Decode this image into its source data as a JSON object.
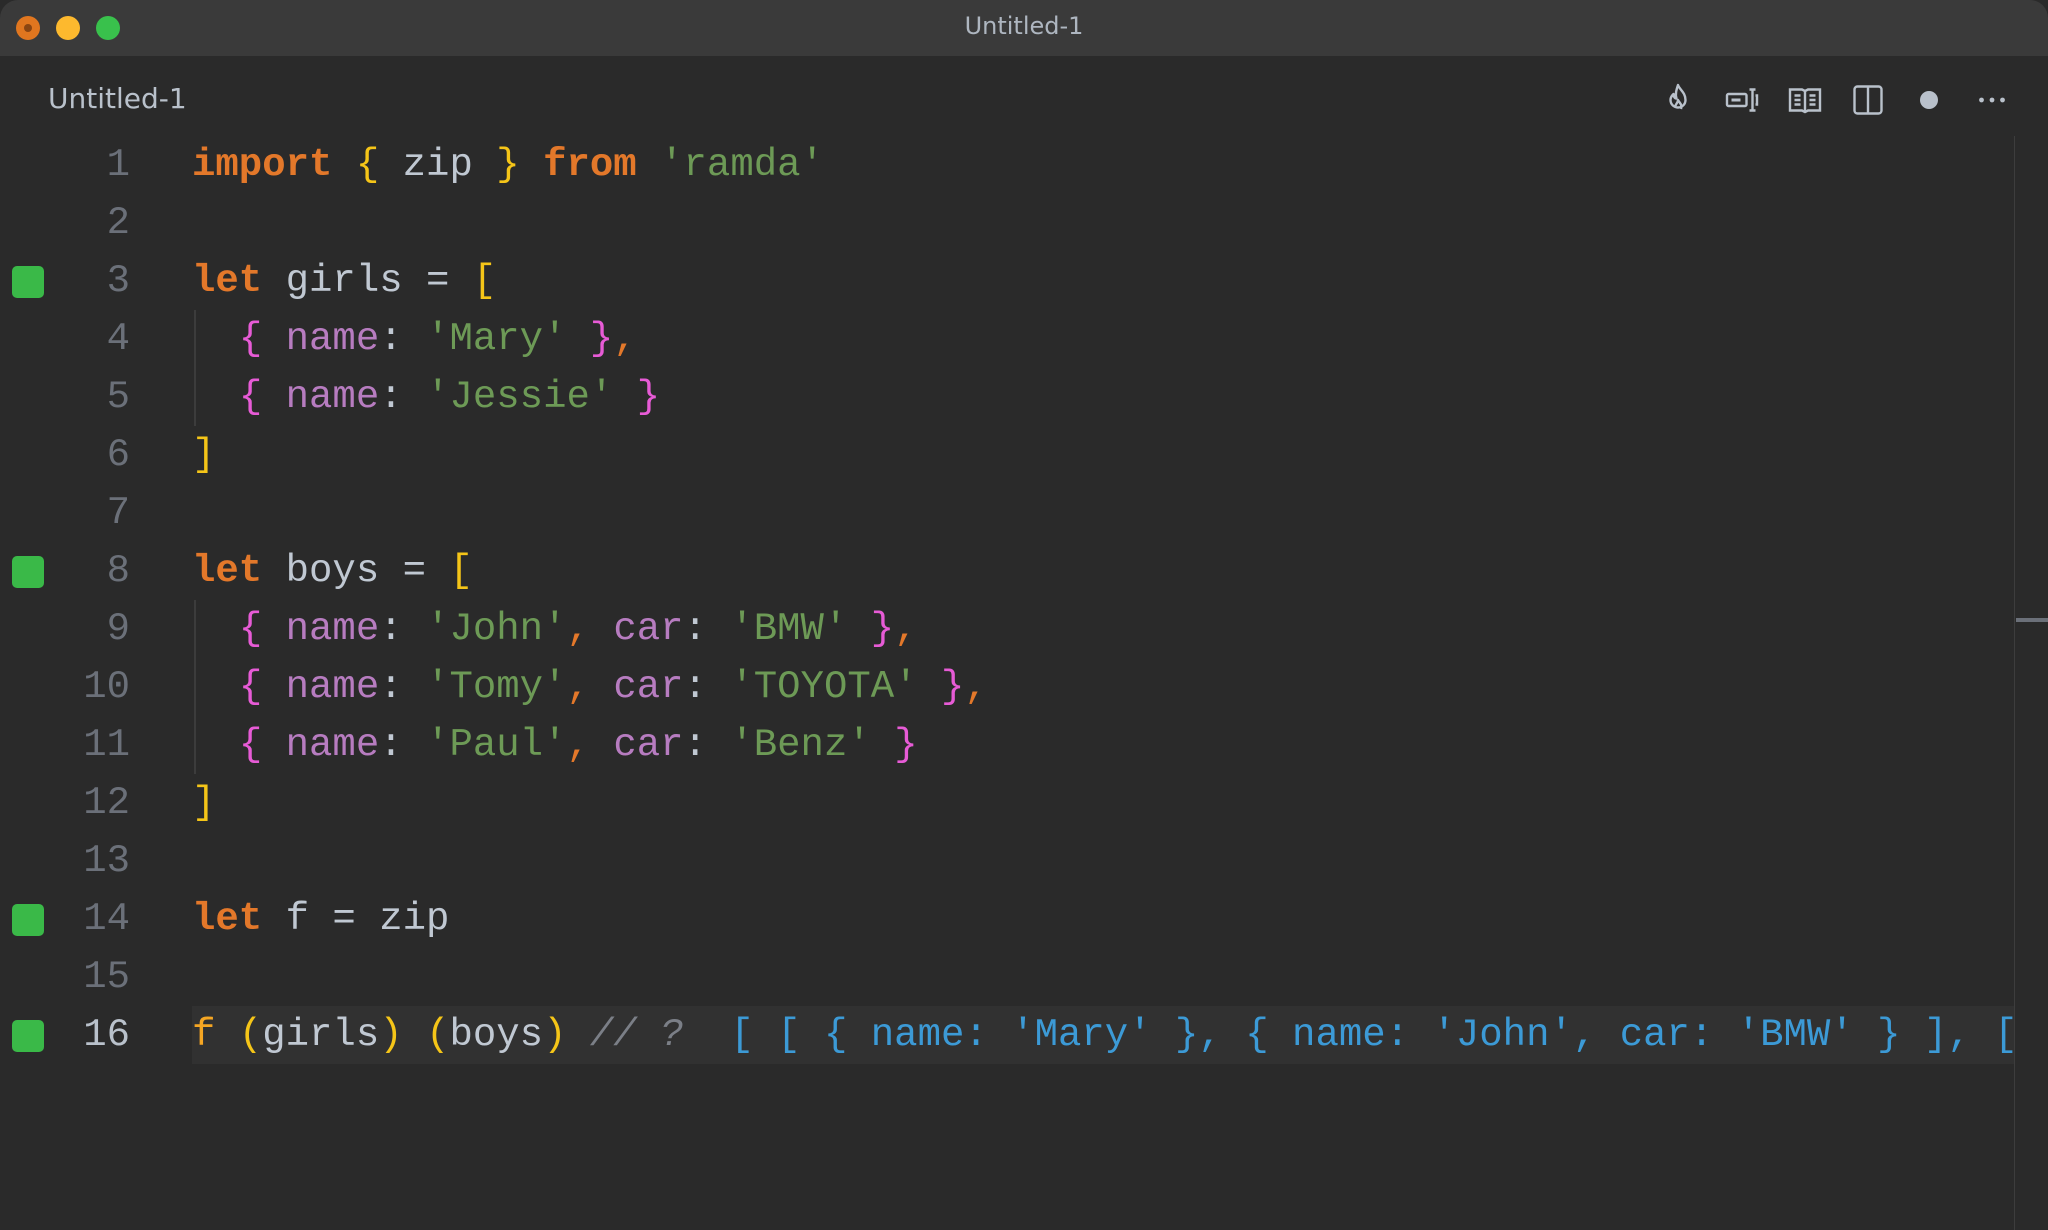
{
  "window": {
    "title": "Untitled-1",
    "traffic_lights": [
      "close",
      "minimize",
      "maximize"
    ]
  },
  "tab": {
    "label": "Untitled-1"
  },
  "toolbar": {
    "icons": [
      "flame-icon",
      "text-cursor-box-icon",
      "open-book-icon",
      "split-editor-icon",
      "unsaved-dot-icon",
      "more-icon"
    ]
  },
  "colors": {
    "keyword": "#e3782a",
    "bracket": "#f5c518",
    "brace": "#e75bd6",
    "property": "#b77cc0",
    "string": "#6d9a56",
    "result": "#3c9ad6",
    "marker": "#3ab948"
  },
  "lines": [
    {
      "n": "1",
      "marker": false,
      "tokens": [
        [
          "k",
          "import"
        ],
        [
          "id",
          " "
        ],
        [
          "br",
          "{"
        ],
        [
          "id",
          " zip "
        ],
        [
          "br",
          "}"
        ],
        [
          "id",
          " "
        ],
        [
          "k",
          "from"
        ],
        [
          "id",
          " "
        ],
        [
          "str",
          "'ramda'"
        ]
      ]
    },
    {
      "n": "2",
      "marker": false,
      "tokens": []
    },
    {
      "n": "3",
      "marker": true,
      "tokens": [
        [
          "k",
          "let"
        ],
        [
          "id",
          " girls = "
        ],
        [
          "br",
          "["
        ]
      ]
    },
    {
      "n": "4",
      "marker": false,
      "tokens": [
        [
          "id",
          "  "
        ],
        [
          "cb",
          "{"
        ],
        [
          "id",
          " "
        ],
        [
          "prop",
          "name"
        ],
        [
          "pun",
          ": "
        ],
        [
          "str",
          "'Mary'"
        ],
        [
          "id",
          " "
        ],
        [
          "cb",
          "}"
        ],
        [
          "comma",
          ","
        ]
      ]
    },
    {
      "n": "5",
      "marker": false,
      "tokens": [
        [
          "id",
          "  "
        ],
        [
          "cb",
          "{"
        ],
        [
          "id",
          " "
        ],
        [
          "prop",
          "name"
        ],
        [
          "pun",
          ": "
        ],
        [
          "str",
          "'Jessie'"
        ],
        [
          "id",
          " "
        ],
        [
          "cb",
          "}"
        ]
      ]
    },
    {
      "n": "6",
      "marker": false,
      "tokens": [
        [
          "br",
          "]"
        ]
      ]
    },
    {
      "n": "7",
      "marker": false,
      "tokens": []
    },
    {
      "n": "8",
      "marker": true,
      "tokens": [
        [
          "k",
          "let"
        ],
        [
          "id",
          " boys = "
        ],
        [
          "br",
          "["
        ]
      ]
    },
    {
      "n": "9",
      "marker": false,
      "tokens": [
        [
          "id",
          "  "
        ],
        [
          "cb",
          "{"
        ],
        [
          "id",
          " "
        ],
        [
          "prop",
          "name"
        ],
        [
          "pun",
          ": "
        ],
        [
          "str",
          "'John'"
        ],
        [
          "comma",
          ","
        ],
        [
          "id",
          " "
        ],
        [
          "prop",
          "car"
        ],
        [
          "pun",
          ": "
        ],
        [
          "str",
          "'BMW'"
        ],
        [
          "id",
          " "
        ],
        [
          "cb",
          "}"
        ],
        [
          "comma",
          ","
        ]
      ]
    },
    {
      "n": "10",
      "marker": false,
      "tokens": [
        [
          "id",
          "  "
        ],
        [
          "cb",
          "{"
        ],
        [
          "id",
          " "
        ],
        [
          "prop",
          "name"
        ],
        [
          "pun",
          ": "
        ],
        [
          "str",
          "'Tomy'"
        ],
        [
          "comma",
          ","
        ],
        [
          "id",
          " "
        ],
        [
          "prop",
          "car"
        ],
        [
          "pun",
          ": "
        ],
        [
          "str",
          "'TOYOTA'"
        ],
        [
          "id",
          " "
        ],
        [
          "cb",
          "}"
        ],
        [
          "comma",
          ","
        ]
      ]
    },
    {
      "n": "11",
      "marker": false,
      "tokens": [
        [
          "id",
          "  "
        ],
        [
          "cb",
          "{"
        ],
        [
          "id",
          " "
        ],
        [
          "prop",
          "name"
        ],
        [
          "pun",
          ": "
        ],
        [
          "str",
          "'Paul'"
        ],
        [
          "comma",
          ","
        ],
        [
          "id",
          " "
        ],
        [
          "prop",
          "car"
        ],
        [
          "pun",
          ": "
        ],
        [
          "str",
          "'Benz'"
        ],
        [
          "id",
          " "
        ],
        [
          "cb",
          "}"
        ]
      ]
    },
    {
      "n": "12",
      "marker": false,
      "tokens": [
        [
          "br",
          "]"
        ]
      ]
    },
    {
      "n": "13",
      "marker": false,
      "tokens": []
    },
    {
      "n": "14",
      "marker": true,
      "tokens": [
        [
          "k",
          "let"
        ],
        [
          "id",
          " f = zip"
        ]
      ]
    },
    {
      "n": "15",
      "marker": false,
      "tokens": []
    },
    {
      "n": "16",
      "marker": true,
      "current": true,
      "tokens": [
        [
          "fn",
          "f"
        ],
        [
          "id",
          " "
        ],
        [
          "br",
          "("
        ],
        [
          "id",
          "girls"
        ],
        [
          "br",
          ")"
        ],
        [
          "id",
          " "
        ],
        [
          "br",
          "("
        ],
        [
          "id",
          "boys"
        ],
        [
          "br",
          ")"
        ],
        [
          "id",
          " "
        ],
        [
          "com",
          "// ?"
        ],
        [
          "id",
          "  "
        ],
        [
          "res",
          "[ [ { name: 'Mary' }, { name: 'John', car: 'BMW' } ], [ [ { name: 'Jessie' }, { name: 'Tomy', car: 'TOYOTA' } ] ]"
        ]
      ]
    }
  ]
}
